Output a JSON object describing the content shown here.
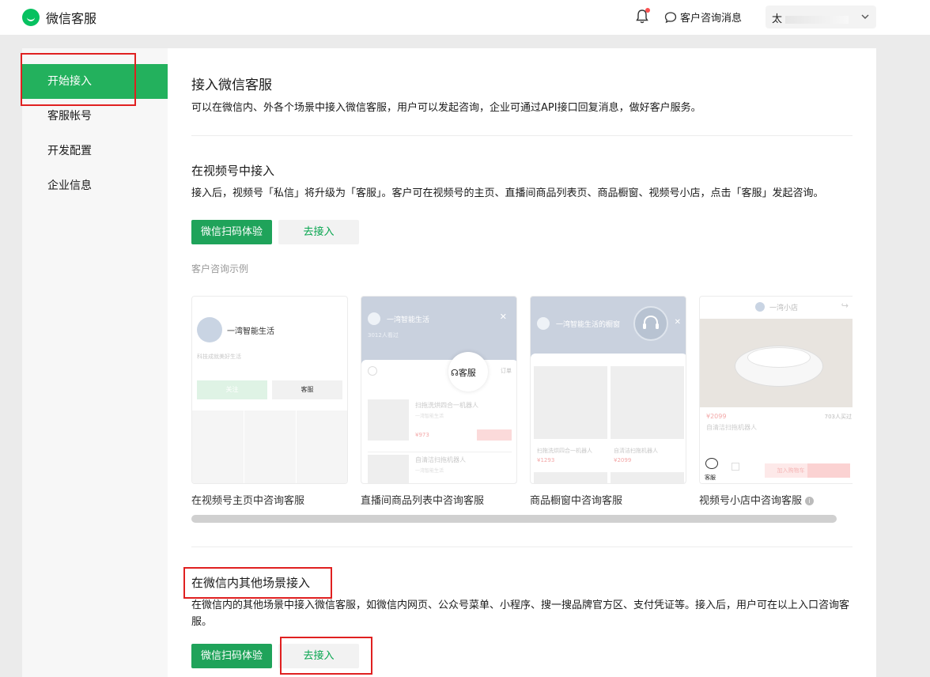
{
  "app": {
    "title": "微信客服"
  },
  "header": {
    "message_label": "客户咨询消息",
    "account_initial": "太"
  },
  "sidebar": {
    "items": [
      {
        "label": "开始接入",
        "active": true
      },
      {
        "label": "客服帐号",
        "active": false
      },
      {
        "label": "开发配置",
        "active": false
      },
      {
        "label": "企业信息",
        "active": false
      }
    ]
  },
  "intro": {
    "title": "接入微信客服",
    "description": "可以在微信内、外各个场景中接入微信客服，用户可以发起咨询，企业可通过API接口回复消息，做好客户服务。"
  },
  "channels": {
    "title": "在视频号中接入",
    "description": "接入后，视频号「私信」将升级为「客服」。客户可在视频号的主页、直播间商品列表页、商品橱窗、视频号小店，点击「客服」发起咨询。",
    "scan_button": "微信扫码体验",
    "connect_button": "去接入",
    "examples_label": "客户咨询示例",
    "examples": [
      {
        "caption": "在视频号主页中咨询客服"
      },
      {
        "caption": "直播间商品列表中咨询客服"
      },
      {
        "caption": "商品橱窗中咨询客服"
      },
      {
        "caption": "视频号小店中咨询客服"
      }
    ]
  },
  "card1": {
    "name": "一湾智能生活",
    "sub": "科技成就美好生活",
    "follow": "关注",
    "service": "客服"
  },
  "card2": {
    "name": "一湾智能生活",
    "viewers": "3012人看过",
    "service": "客服",
    "orders": "订单",
    "item1": "扫拖洗烘四合一机器人",
    "item1_sub": "一湾智能生活",
    "item1_price": "¥973",
    "item2": "自清洁扫拖机器人",
    "item2_sub": "一湾智能生活"
  },
  "card3": {
    "name": "一湾智能生活的橱窗",
    "item1": "扫拖洗烘四合一机器人",
    "item1_price": "¥1293",
    "item2": "自清洁扫拖机器人",
    "item2_price": "¥2099"
  },
  "card4": {
    "shop": "一湾小店",
    "price": "¥2099",
    "sold": "703人买过",
    "product": "自清洁扫拖机器人",
    "service": "客服",
    "cart": "加入购物车"
  },
  "other": {
    "title": "在微信内其他场景接入",
    "description": "在微信内的其他场景中接入微信客服，如微信内网页、公众号菜单、小程序、搜一搜品牌官方区、支付凭证等。接入后，用户可在以上入口咨询客服。",
    "scan_button": "微信扫码体验",
    "connect_button": "去接入"
  },
  "colors": {
    "brand": "#07c160",
    "active_nav": "#23b15d",
    "button_green": "#1fa35a",
    "highlight": "#e02020"
  }
}
